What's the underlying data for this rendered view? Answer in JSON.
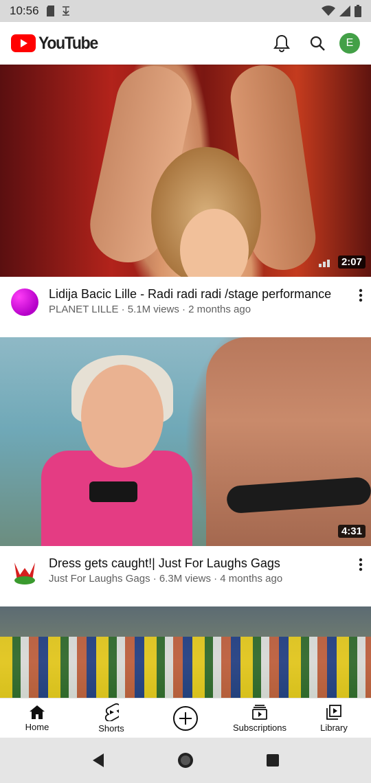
{
  "status_bar": {
    "time": "10:56"
  },
  "header": {
    "logo_text": "YouTube",
    "avatar_letter": "E"
  },
  "videos": [
    {
      "title": "Lidija Bacic Lille - Radi radi radi /stage performance",
      "channel": "PLANET LILLE",
      "views": "5.1M views",
      "age": "2 months ago",
      "duration": "2:07"
    },
    {
      "title": "Dress gets caught!| Just For Laughs Gags",
      "channel": "Just For Laughs Gags",
      "views": "6.3M views",
      "age": "4 months ago",
      "duration": "4:31"
    }
  ],
  "bottom_nav": {
    "home": "Home",
    "shorts": "Shorts",
    "subscriptions": "Subscriptions",
    "library": "Library"
  },
  "colors": {
    "brand_red": "#ff0000",
    "avatar_green": "#43a047"
  }
}
